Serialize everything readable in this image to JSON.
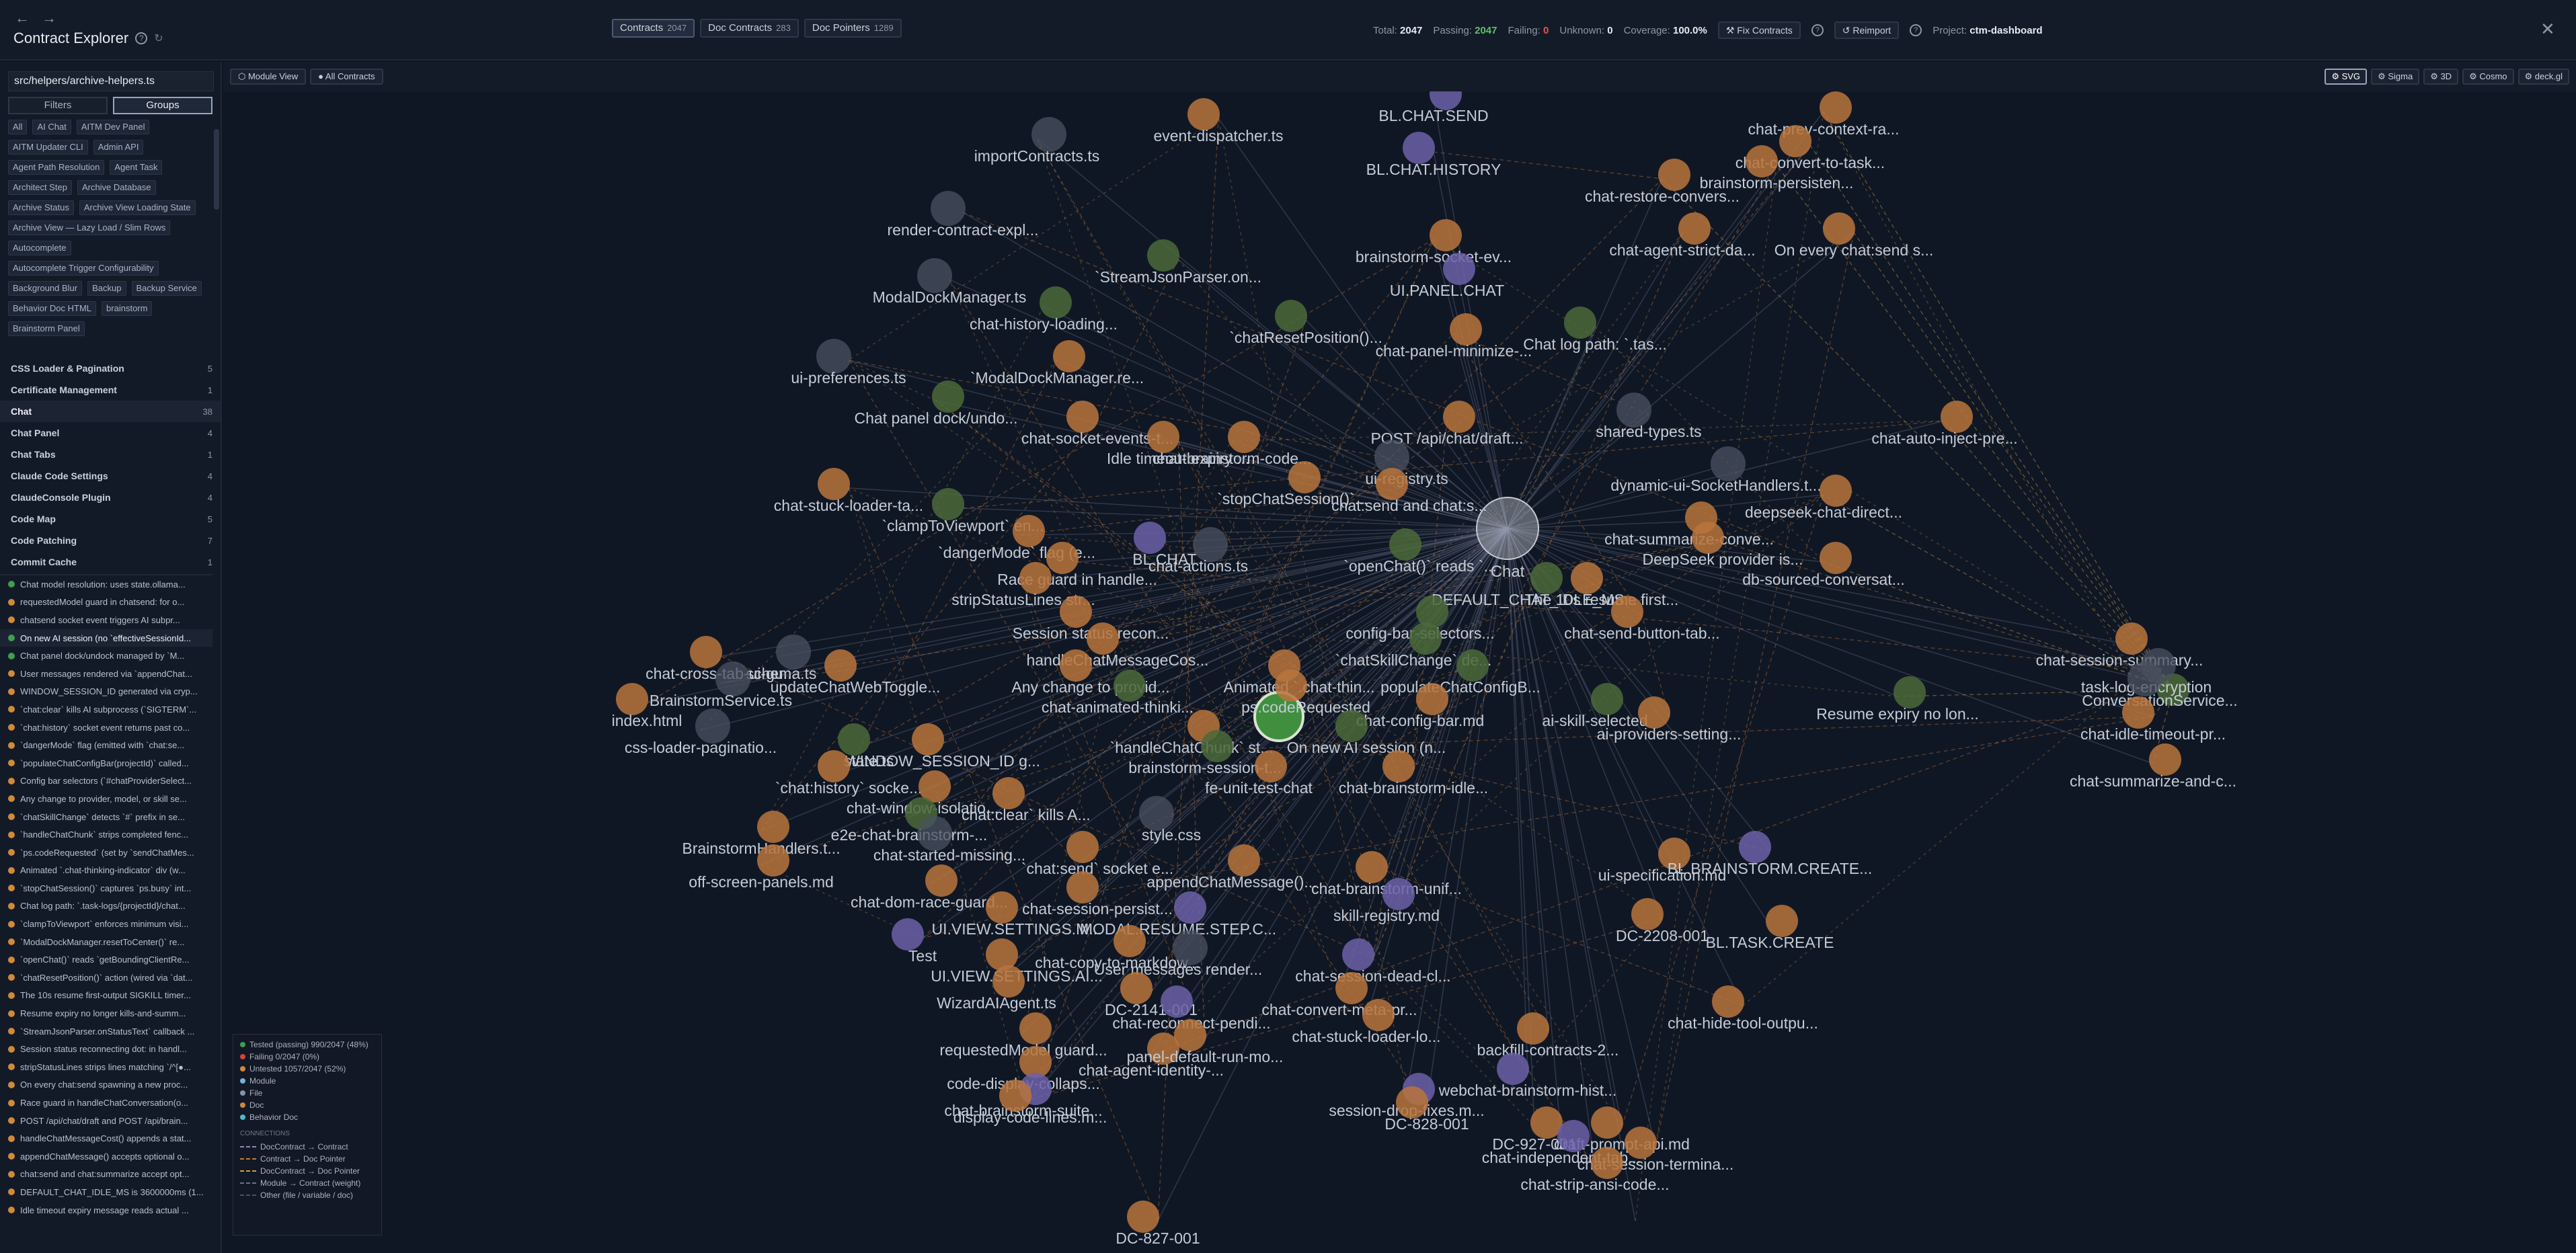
{
  "header": {
    "back_icon": "arrow-left-icon",
    "forward_icon": "arrow-right-icon",
    "title": "Contract Explorer",
    "help": "?",
    "tabs": [
      {
        "label": "Contracts",
        "count": "2047",
        "active": true
      },
      {
        "label": "Doc Contracts",
        "count": "283",
        "active": false
      },
      {
        "label": "Doc Pointers",
        "count": "1289",
        "active": false
      }
    ],
    "stats": {
      "total_label": "Total:",
      "total": "2047",
      "passing_label": "Passing:",
      "passing": "2047",
      "failing_label": "Failing:",
      "failing": "0",
      "unknown_label": "Unknown:",
      "unknown": "0",
      "coverage_label": "Coverage:",
      "coverage": "100.0%"
    },
    "fix_button": "⚒ Fix Contracts",
    "reimport_button": "↺ Reimport",
    "project_label": "Project:",
    "project": "ctm-dashboard",
    "close": "✕"
  },
  "sidebar": {
    "file_path": "src/helpers/archive-helpers.ts",
    "seg": {
      "filters": "Filters",
      "groups": "Groups"
    },
    "chips": [
      "All",
      "AI Chat",
      "AITM Dev Panel",
      "AITM Updater CLI",
      "Admin API",
      "Agent Path Resolution",
      "Agent Task",
      "Architect Step",
      "Archive Database",
      "Archive Status",
      "Archive View Loading State",
      "Archive View — Lazy Load / Slim Rows",
      "Autocomplete",
      "Autocomplete Trigger Configurability",
      "Background Blur",
      "Backup",
      "Backup Service",
      "Behavior Doc HTML",
      "brainstorm",
      "Brainstorm Panel"
    ],
    "groups": [
      {
        "name": "CSS Loader & Pagination",
        "count": "5"
      },
      {
        "name": "Certificate Management",
        "count": "1"
      },
      {
        "name": "Chat",
        "count": "38",
        "active": true
      },
      {
        "name": "Chat Panel",
        "count": "4"
      },
      {
        "name": "Chat Tabs",
        "count": "1"
      },
      {
        "name": "Claude Code Settings",
        "count": "4"
      },
      {
        "name": "ClaudeConsole Plugin",
        "count": "4"
      },
      {
        "name": "Code Map",
        "count": "5"
      },
      {
        "name": "Code Patching",
        "count": "7"
      },
      {
        "name": "Commit Cache",
        "count": "1"
      }
    ],
    "items": [
      "Chat model resolution: uses state.ollama...",
      "requestedModel guard in chatsend: for o...",
      "chatsend socket event triggers AI subpr...",
      "On new AI session (no `effectiveSessionId...",
      "Chat panel dock/undock managed by `M...",
      "User messages rendered via `appendChat...",
      "WINDOW_SESSION_ID generated via cryp...",
      "`chat:clear` kills AI subprocess (`SIGTERM`...",
      "`chat:history` socket event returns past co...",
      "`dangerMode` flag (emitted with `chat:se...",
      "`populateChatConfigBar(projectId)` called...",
      "Config bar selectors (`#chatProviderSelect...",
      "Any change to provider, model, or skill se...",
      "`chatSkillChange` detects `#` prefix in se...",
      "`handleChatChunk` strips completed fenc...",
      "`ps.codeRequested` (set by `sendChatMes...",
      "Animated `.chat-thinking-indicator` div (w...",
      "`stopChatSession()` captures `ps.busy` int...",
      "Chat log path: `.task-logs/{projectId}/chat...",
      "`clampToViewport` enforces minimum visi...",
      "`ModalDockManager.resetToCenter()` re...",
      "`openChat()` reads `getBoundingClientRe...",
      "`chatResetPosition()` action (wired via `dat...",
      "The 10s resume first-output SIGKILL timer...",
      "Resume expiry no longer kills-and-summ...",
      "`StreamJsonParser.onStatusText` callback ...",
      "Session status reconnecting dot: in handl...",
      "stripStatusLines strips lines matching `/^[●...",
      "On every chat:send spawning a new proc...",
      "Race guard in handleChatConversation(o...",
      "POST /api/chat/draft and POST /api/brain...",
      "handleChatMessageCost() appends a stat...",
      "appendChatMessage() accepts optional o...",
      "chat:send and chat:summarize accept opt...",
      "DEFAULT_CHAT_IDLE_MS is 3600000ms (1...",
      "Idle timeout expiry message reads actual ..."
    ],
    "item_status": [
      "green",
      "orange",
      "orange",
      "green",
      "green",
      "orange",
      "orange",
      "orange",
      "orange",
      "orange",
      "orange",
      "orange",
      "orange",
      "orange",
      "orange",
      "orange",
      "orange",
      "orange",
      "orange",
      "orange",
      "orange",
      "orange",
      "orange",
      "orange",
      "orange",
      "orange",
      "orange",
      "orange",
      "orange",
      "orange",
      "orange",
      "orange",
      "orange",
      "orange",
      "orange",
      "orange"
    ]
  },
  "graph": {
    "view_buttons": [
      "⬡ Module View",
      "● All Contracts"
    ],
    "renderers": [
      {
        "label": "⚙ SVG",
        "active": true
      },
      {
        "label": "⚙ Sigma",
        "active": false
      },
      {
        "label": "⚙ 3D",
        "active": false
      },
      {
        "label": "⚙ Cosmo",
        "active": false
      },
      {
        "label": "⚙ deck.gl",
        "active": false
      }
    ],
    "hub": {
      "label": "Chat"
    },
    "selected_label": "Chat",
    "node_colors": {
      "contract_ok": "#d4a84a",
      "contract_orange": "#c9783a",
      "module": "#5a6b50",
      "file": "#5b6270",
      "doc": "#7a6fb0",
      "green": "#3f8f3f"
    },
    "node_labels": [
      "event-dispatcher.ts",
      "BL.CHAT.SEND",
      "BL.CHAT.HISTORY",
      "chat-prev-context-ra...",
      "chat-convert-to-task...",
      "importContracts.ts",
      "brainstorm-persisten...",
      "chat-restore-convers...",
      "render-contract-expl...",
      "chat-agent-strict-da...",
      "On every chat:send s...",
      "brainstorm-socket-ev...",
      "`StreamJsonParser.on...",
      "UI.PANEL.CHAT",
      "ModalDockManager.ts",
      "chat-history-loading...",
      "`chatResetPosition()...",
      "chat-panel-minimize-...",
      "Chat log path: `.tas...",
      "`ModalDockManager.re...",
      "ui-preferences.ts",
      "Chat panel dock/undo...",
      "chat-socket-events-t...",
      "POST /api/chat/draft...",
      "shared-types.ts",
      "chat-auto-inject-pre...",
      "Idle timeout expiry ...",
      "chat-brainstorm-code...",
      "ui-registry.ts",
      "dynamic-ui-SocketHandlers.t...",
      "chat-stuck-loader-ta...",
      "`stopChatSession()`...",
      "`chat:send and chat:s...",
      "deepseek-chat-direct...",
      "`clampToViewport` en...",
      "`dangerMode` flag (e...",
      "BL.CHAT",
      "chat-summarize-conve...",
      "DeepSeek provider is...",
      "chat-actions.ts",
      "`openChat()` reads `...",
      "db-sourced-conversat...",
      "Race guard in handle...",
      "stripStatusLines str...",
      "The 10s resume first...",
      "DEFAULT_CHAT_IDLE_MS...",
      "Session status recon...",
      "config-bar-selectors...",
      "chat-send-button-tab...",
      "chat-session-summary...",
      "handleChatMessageCos...",
      "`chatSkillChange` de...",
      "chat-cross-tab-ui-gu...",
      "schema.ts",
      "Any change to provid...",
      "populateChatConfigB...",
      "updateChatWebToggle...",
      "task-log-encryption",
      "ConversationService...",
      "BrainstormService.ts",
      "Animated `.chat-thin...",
      "chat-animated-thinki...",
      "ps.codeRequested",
      "Resume expiry no lon...",
      "index.html",
      "chat-config-bar.md",
      "chat-idle-timeout-pr...",
      "ai-skill-selected",
      "ai-providers-setting...",
      "css-loader-paginatio...",
      "state.ts",
      "`handleChatChunk` st...",
      "On new AI session (n...",
      "chat-summarize-and-c...",
      "WINDOW_SESSION_ID g...",
      "brainstorm-session-t...",
      "`chat:history` socke...",
      "fe-unit-test-chat",
      "chat-brainstorm-idle...",
      "chat-window-isolatio...",
      "`chat:clear` kills A...",
      "e2e-chat-brainstorm-...",
      "style.css",
      "BrainstormHandlers.t...",
      "chat-started-missing...",
      "ui-specification.md",
      "BL.BRAINSTORM.CREATE...",
      "off-screen-panels.md",
      "`chat:send` socket e...",
      "appendChatMessage()...",
      "chat-brainstorm-unif...",
      "chat-dom-race-guard...",
      "chat-session-persist...",
      "skill-registry.md",
      "UI.VIEW.SETTINGS.M...",
      "MODAL.RESUME.STEP.C...",
      "DC-2208-001",
      "BL.TASK.CREATE",
      "Test",
      "chat-copy-to-markdow...",
      "UI.VIEW.SETTINGS.AI...",
      "User messages render...",
      "chat-session-dead-cl...",
      "WizardAIAgent.ts",
      "DC-2141-001",
      "chat-convert-meta-pr...",
      "chat-reconnect-pendi...",
      "chat-stuck-loader-lo...",
      "chat-hide-tool-outpu...",
      "chat-agent-identity-...",
      "panel-default-run-mo...",
      "requestedModel guard...",
      "backfill-contracts-2...",
      "code-display-collaps...",
      "webchat-brainstorm-hist...",
      "chat-brainstorm-suite...",
      "display-code-lines.m...",
      "session-drop-fixes.m...",
      "DC-828-001",
      "DC-927-001",
      "draft-prompt-api.md",
      "chat-independent-tab...",
      "chat-session-termina...",
      "chat-strip-ansi-code...",
      "DC-827-001"
    ]
  },
  "legend": {
    "entries": [
      {
        "label": "Tested (passing) 990/2047 (48%)",
        "color": "#3f9f4a"
      },
      {
        "label": "Failing 0/2047 (0%)",
        "color": "#d0453d"
      },
      {
        "label": "Untested 1057/2047 (52%)",
        "color": "#d08a3a"
      },
      {
        "label": "Module",
        "color": "#7ab0d8"
      },
      {
        "label": "File",
        "color": "#8a93a3"
      },
      {
        "label": "Doc",
        "color": "#c98a3a"
      },
      {
        "label": "Behavior Doc",
        "color": "#4fb8c9"
      }
    ],
    "connections_title": "CONNECTIONS",
    "connections": [
      {
        "label": "DocContract → Contract",
        "color": "#8a8fb0"
      },
      {
        "label": "Contract → Doc Pointer",
        "color": "#c9783a"
      },
      {
        "label": "DocContract → Doc Pointer",
        "color": "#c9a04a"
      },
      {
        "label": "Module → Contract (weight)",
        "color": "#6a7484"
      },
      {
        "label": "Other (file / variable / doc)",
        "color": "#4a5262"
      }
    ]
  }
}
